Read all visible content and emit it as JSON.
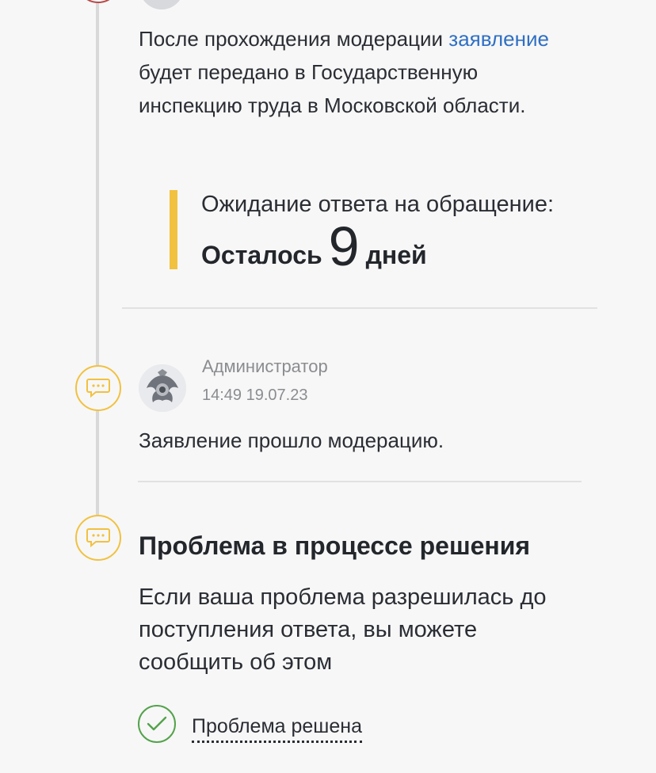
{
  "moderation_notice": {
    "before_link": "После прохождения модерации",
    "link_text": "заявление",
    "after_link": "будет передано в Государственную инспекцию труда в Московской области."
  },
  "waiting": {
    "title": "Ожидание ответа на обращение:",
    "prefix": "Осталось",
    "days": "9",
    "suffix": "дней"
  },
  "admin_message": {
    "author": "Администратор",
    "timestamp": "14:49 19.07.23",
    "text": "Заявление прошло модерацию."
  },
  "problem": {
    "title": "Проблема в процессе решения",
    "description": "Если ваша проблема разрешилась до поступления ответа, вы можете сообщить об этом",
    "solved_button": "Проблема решена"
  },
  "colors": {
    "accent_yellow": "#f1c140",
    "link_blue": "#2f6fc4",
    "check_green": "#54a24c",
    "status_red": "#b9494a"
  },
  "icons": {
    "message": "chat-bubble-icon",
    "avatar": "emblem-avatar",
    "check": "check-icon"
  }
}
